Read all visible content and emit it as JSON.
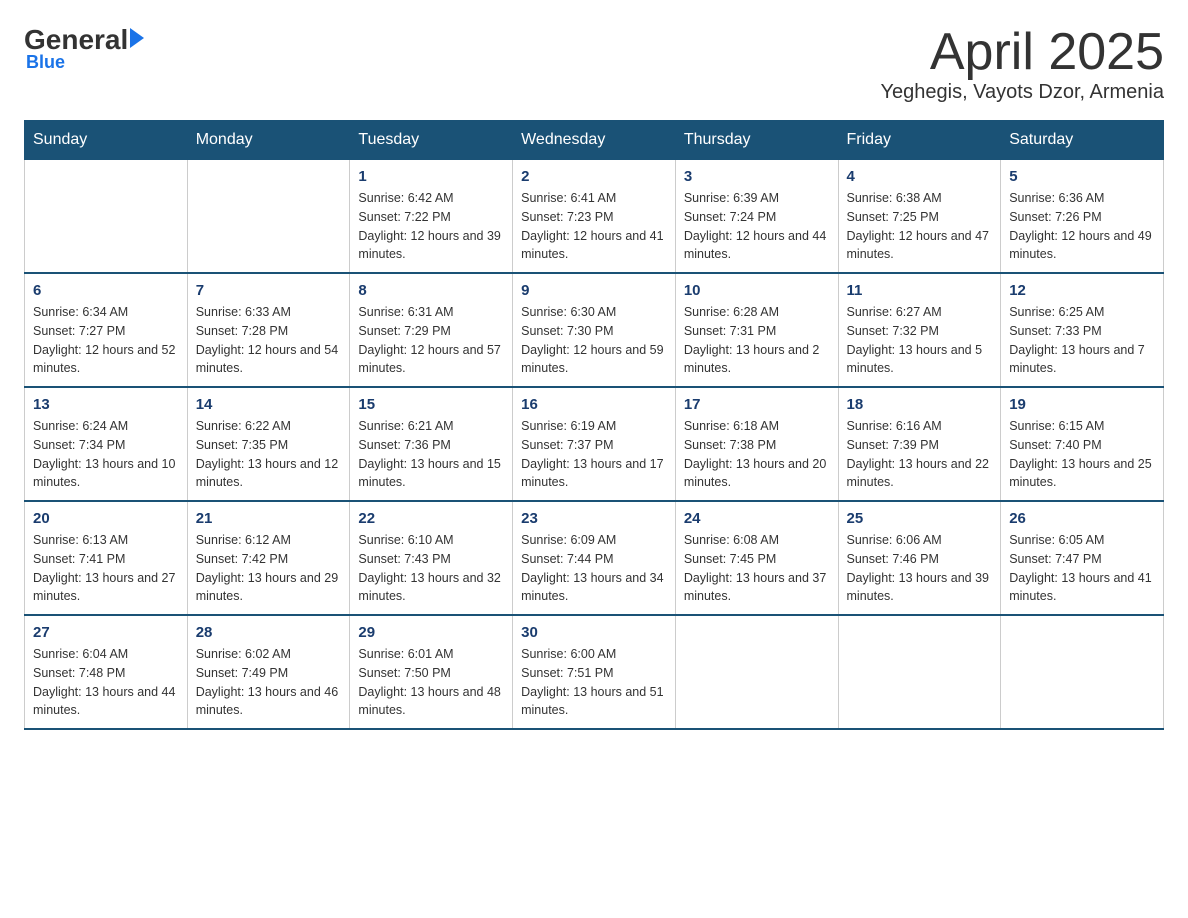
{
  "logo": {
    "general": "General",
    "blue": "Blue"
  },
  "header": {
    "month_year": "April 2025",
    "location": "Yeghegis, Vayots Dzor, Armenia"
  },
  "weekdays": [
    "Sunday",
    "Monday",
    "Tuesday",
    "Wednesday",
    "Thursday",
    "Friday",
    "Saturday"
  ],
  "weeks": [
    [
      {
        "day": "",
        "info": ""
      },
      {
        "day": "",
        "info": ""
      },
      {
        "day": "1",
        "info": "Sunrise: 6:42 AM\nSunset: 7:22 PM\nDaylight: 12 hours and 39 minutes."
      },
      {
        "day": "2",
        "info": "Sunrise: 6:41 AM\nSunset: 7:23 PM\nDaylight: 12 hours and 41 minutes."
      },
      {
        "day": "3",
        "info": "Sunrise: 6:39 AM\nSunset: 7:24 PM\nDaylight: 12 hours and 44 minutes."
      },
      {
        "day": "4",
        "info": "Sunrise: 6:38 AM\nSunset: 7:25 PM\nDaylight: 12 hours and 47 minutes."
      },
      {
        "day": "5",
        "info": "Sunrise: 6:36 AM\nSunset: 7:26 PM\nDaylight: 12 hours and 49 minutes."
      }
    ],
    [
      {
        "day": "6",
        "info": "Sunrise: 6:34 AM\nSunset: 7:27 PM\nDaylight: 12 hours and 52 minutes."
      },
      {
        "day": "7",
        "info": "Sunrise: 6:33 AM\nSunset: 7:28 PM\nDaylight: 12 hours and 54 minutes."
      },
      {
        "day": "8",
        "info": "Sunrise: 6:31 AM\nSunset: 7:29 PM\nDaylight: 12 hours and 57 minutes."
      },
      {
        "day": "9",
        "info": "Sunrise: 6:30 AM\nSunset: 7:30 PM\nDaylight: 12 hours and 59 minutes."
      },
      {
        "day": "10",
        "info": "Sunrise: 6:28 AM\nSunset: 7:31 PM\nDaylight: 13 hours and 2 minutes."
      },
      {
        "day": "11",
        "info": "Sunrise: 6:27 AM\nSunset: 7:32 PM\nDaylight: 13 hours and 5 minutes."
      },
      {
        "day": "12",
        "info": "Sunrise: 6:25 AM\nSunset: 7:33 PM\nDaylight: 13 hours and 7 minutes."
      }
    ],
    [
      {
        "day": "13",
        "info": "Sunrise: 6:24 AM\nSunset: 7:34 PM\nDaylight: 13 hours and 10 minutes."
      },
      {
        "day": "14",
        "info": "Sunrise: 6:22 AM\nSunset: 7:35 PM\nDaylight: 13 hours and 12 minutes."
      },
      {
        "day": "15",
        "info": "Sunrise: 6:21 AM\nSunset: 7:36 PM\nDaylight: 13 hours and 15 minutes."
      },
      {
        "day": "16",
        "info": "Sunrise: 6:19 AM\nSunset: 7:37 PM\nDaylight: 13 hours and 17 minutes."
      },
      {
        "day": "17",
        "info": "Sunrise: 6:18 AM\nSunset: 7:38 PM\nDaylight: 13 hours and 20 minutes."
      },
      {
        "day": "18",
        "info": "Sunrise: 6:16 AM\nSunset: 7:39 PM\nDaylight: 13 hours and 22 minutes."
      },
      {
        "day": "19",
        "info": "Sunrise: 6:15 AM\nSunset: 7:40 PM\nDaylight: 13 hours and 25 minutes."
      }
    ],
    [
      {
        "day": "20",
        "info": "Sunrise: 6:13 AM\nSunset: 7:41 PM\nDaylight: 13 hours and 27 minutes."
      },
      {
        "day": "21",
        "info": "Sunrise: 6:12 AM\nSunset: 7:42 PM\nDaylight: 13 hours and 29 minutes."
      },
      {
        "day": "22",
        "info": "Sunrise: 6:10 AM\nSunset: 7:43 PM\nDaylight: 13 hours and 32 minutes."
      },
      {
        "day": "23",
        "info": "Sunrise: 6:09 AM\nSunset: 7:44 PM\nDaylight: 13 hours and 34 minutes."
      },
      {
        "day": "24",
        "info": "Sunrise: 6:08 AM\nSunset: 7:45 PM\nDaylight: 13 hours and 37 minutes."
      },
      {
        "day": "25",
        "info": "Sunrise: 6:06 AM\nSunset: 7:46 PM\nDaylight: 13 hours and 39 minutes."
      },
      {
        "day": "26",
        "info": "Sunrise: 6:05 AM\nSunset: 7:47 PM\nDaylight: 13 hours and 41 minutes."
      }
    ],
    [
      {
        "day": "27",
        "info": "Sunrise: 6:04 AM\nSunset: 7:48 PM\nDaylight: 13 hours and 44 minutes."
      },
      {
        "day": "28",
        "info": "Sunrise: 6:02 AM\nSunset: 7:49 PM\nDaylight: 13 hours and 46 minutes."
      },
      {
        "day": "29",
        "info": "Sunrise: 6:01 AM\nSunset: 7:50 PM\nDaylight: 13 hours and 48 minutes."
      },
      {
        "day": "30",
        "info": "Sunrise: 6:00 AM\nSunset: 7:51 PM\nDaylight: 13 hours and 51 minutes."
      },
      {
        "day": "",
        "info": ""
      },
      {
        "day": "",
        "info": ""
      },
      {
        "day": "",
        "info": ""
      }
    ]
  ]
}
